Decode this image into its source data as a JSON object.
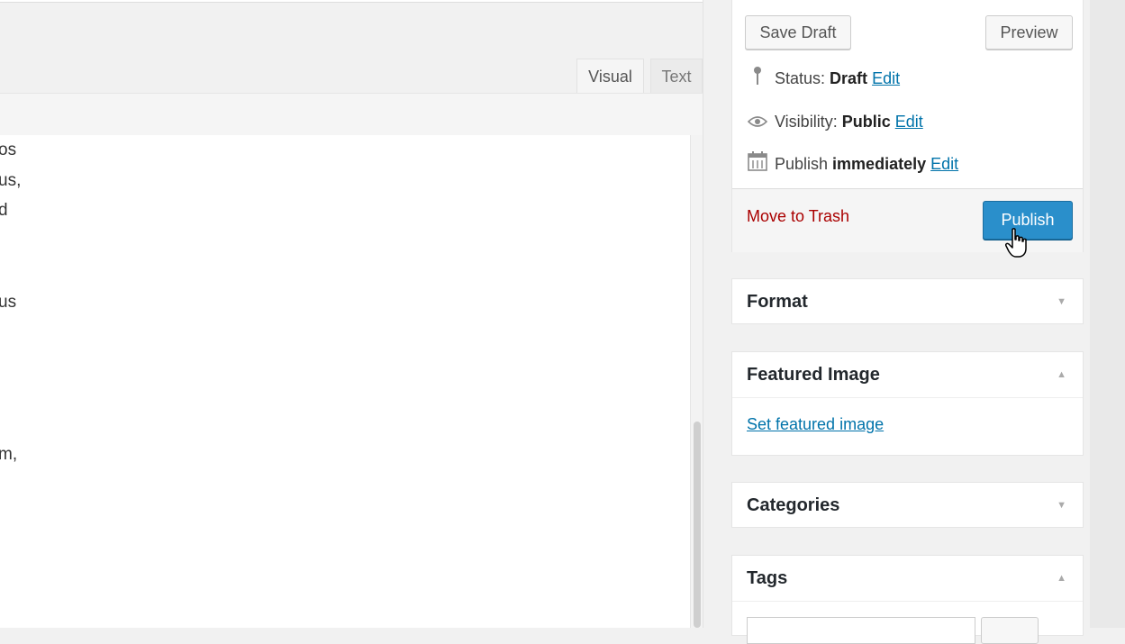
{
  "editor": {
    "tabs": [
      {
        "label": "Visual",
        "active": true
      },
      {
        "label": "Text",
        "active": false
      }
    ],
    "content_fragments": [
      "os",
      "us,",
      "d",
      "us",
      "m,"
    ]
  },
  "publish": {
    "save_draft_label": "Save Draft",
    "preview_label": "Preview",
    "status": {
      "label": "Status: ",
      "value": "Draft",
      "edit": "Edit",
      "icon": "pin-icon"
    },
    "visibility": {
      "label": "Visibility: ",
      "value": "Public",
      "edit": "Edit",
      "icon": "eye-icon"
    },
    "schedule": {
      "label": "Publish ",
      "value": "immediately",
      "edit": "Edit",
      "icon": "calendar-icon"
    },
    "trash_label": "Move to Trash",
    "publish_label": "Publish"
  },
  "format_box": {
    "title": "Format",
    "state": "collapsed"
  },
  "featured_image_box": {
    "title": "Featured Image",
    "state": "expanded",
    "link": "Set featured image"
  },
  "categories_box": {
    "title": "Categories",
    "state": "collapsed"
  },
  "tags_box": {
    "title": "Tags",
    "state": "expanded"
  },
  "colors": {
    "primary": "#2a8fcb",
    "link": "#0073aa",
    "danger": "#aa0000"
  }
}
